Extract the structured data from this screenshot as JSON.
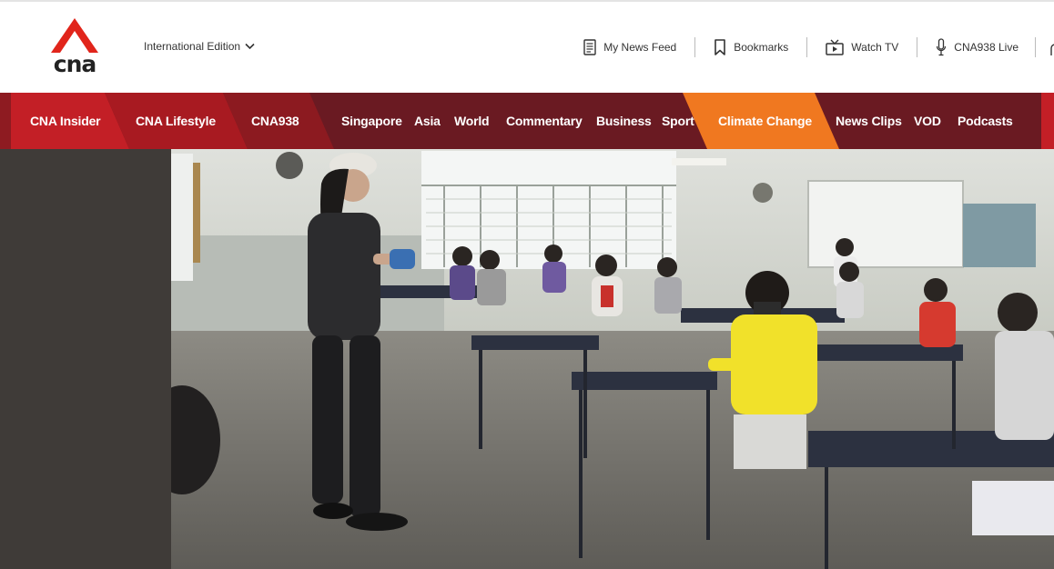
{
  "brand": {
    "logo_text": "cna",
    "color": "#e1251b"
  },
  "header": {
    "edition_label": "International Edition",
    "utilities": [
      {
        "label": "My News Feed",
        "icon": "news-feed-icon"
      },
      {
        "label": "Bookmarks",
        "icon": "bookmark-icon"
      },
      {
        "label": "Watch TV",
        "icon": "tv-icon"
      },
      {
        "label": "CNA938 Live",
        "icon": "microphone-icon"
      }
    ]
  },
  "nav": {
    "featured": [
      {
        "label": "CNA Insider",
        "color": "#c31f26"
      },
      {
        "label": "CNA Lifestyle",
        "color": "#a81a21"
      },
      {
        "label": "CNA938",
        "color": "#8c1a20"
      }
    ],
    "items": [
      "Singapore",
      "Asia",
      "World",
      "Commentary",
      "Business",
      "Sport"
    ],
    "highlight": {
      "label": "Climate Change",
      "color": "#f07820"
    },
    "items_after": [
      "News Clips",
      "VOD",
      "Podcasts"
    ],
    "bar_color": "#6a1a22"
  },
  "hero": {
    "alt": "Classroom with students wearing masks seated at desks while a teacher in black stands at the front"
  }
}
